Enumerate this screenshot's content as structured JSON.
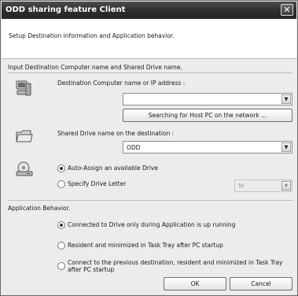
{
  "window": {
    "title": "ODD sharing feature Client",
    "close_glyph": "✕"
  },
  "header": {
    "text": "Setup Destination information and Application behavior."
  },
  "destination": {
    "section_label": "Input Destination Computer name and Shared Drive name.",
    "computer_label": "Destination Computer name or IP address :",
    "computer_value": "",
    "search_button": "Searching for Host PC on the network ...",
    "shared_drive_label": "Shared Drive name on the destination :",
    "shared_drive_value": "ODD",
    "assign_options": [
      {
        "label": "Auto-Assign an available Drive",
        "checked": true
      },
      {
        "label": "Specify Drive Letter",
        "checked": false
      }
    ],
    "drive_letter_value": "M:"
  },
  "behavior": {
    "section_label": "Application Behavior.",
    "options": [
      {
        "label": "Connected to Drive only during Application is up running",
        "checked": true
      },
      {
        "label": "Resident and minimized in Task Tray after PC startup",
        "checked": false
      },
      {
        "label": "Connect to the previous destination, resident and minimized in Task Tray after PC startup",
        "checked": false
      }
    ]
  },
  "buttons": {
    "ok": "OK",
    "cancel": "Cancel"
  },
  "icons": {
    "computer": "computer-icon",
    "folder": "shared-folder-icon",
    "drive": "optical-drive-icon"
  }
}
